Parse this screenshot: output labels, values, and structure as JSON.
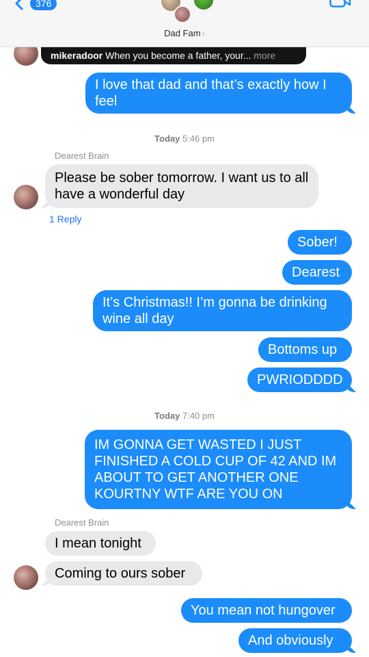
{
  "header": {
    "badge_count": "376",
    "group_name": "Dad Fam",
    "chevron": "›"
  },
  "quoted_post": {
    "username": "mikeradoor",
    "text": "When you become a father, your...",
    "more": "more"
  },
  "messages": [
    {
      "dir": "out",
      "text": "I love that dad and that’s exactly how I feel"
    },
    {
      "dir": "in",
      "sender": "Dearest Brain",
      "text": "Please be sober tomorrow.  I want us to all have a wonderful day",
      "reply": "1 Reply"
    },
    {
      "dir": "out",
      "text": "Sober!"
    },
    {
      "dir": "out",
      "text": "Dearest"
    },
    {
      "dir": "out",
      "text": "It’s Christmas!! I’m gonna be drinking wine all day"
    },
    {
      "dir": "out",
      "text": "Bottoms up"
    },
    {
      "dir": "out",
      "text": "PWRIODDDD"
    },
    {
      "dir": "out",
      "text": "IM GONNA GET WASTED I JUST FINISHED A COLD CUP OF 42 AND IM ABOUT TO GET ANOTHER ONE KOURTNY WTF ARE YOU ON"
    },
    {
      "dir": "in",
      "sender": "Dearest Brain",
      "text": "I mean tonight"
    },
    {
      "dir": "in",
      "text": "Coming to ours sober"
    },
    {
      "dir": "out",
      "text": "You mean not hungover"
    },
    {
      "dir": "out",
      "text": "And obviously"
    }
  ],
  "timestamps": [
    {
      "day": "Today",
      "time": "5:46 pm"
    },
    {
      "day": "Today",
      "time": "7:40 pm"
    }
  ],
  "colors": {
    "outgoing_bubble": "#1b8cf9",
    "incoming_bubble": "#e9e9eb",
    "link": "#1b74e8"
  }
}
